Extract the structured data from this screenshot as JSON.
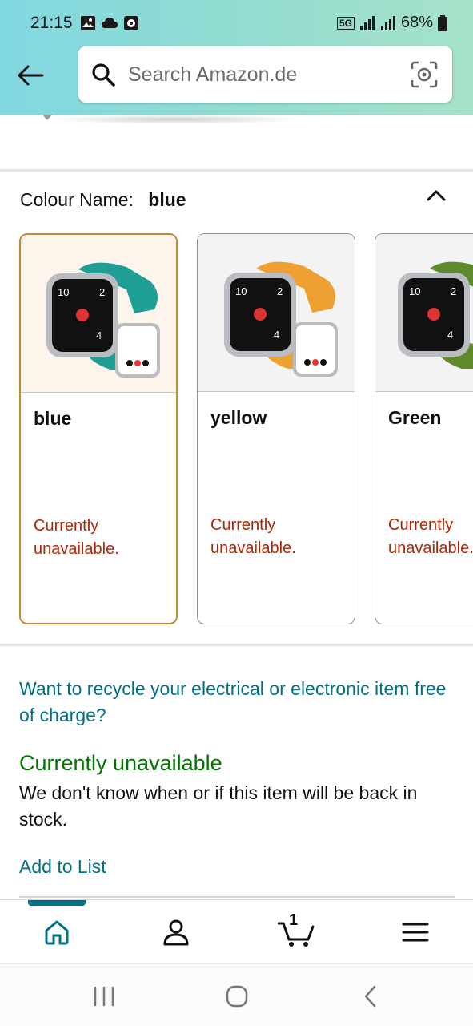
{
  "status_bar": {
    "time": "21:15",
    "network": "5G",
    "battery": "68%"
  },
  "header": {
    "search_placeholder": "Search Amazon.de"
  },
  "colour": {
    "label": "Colour Name:",
    "selected": "blue",
    "options": [
      {
        "name": "blue",
        "availability_line1": "Currently",
        "availability_line2": "unavailable.",
        "band_color": "#1f9e93"
      },
      {
        "name": "yellow",
        "availability_line1": "Currently",
        "availability_line2": "unavailable.",
        "band_color": "#eea032"
      },
      {
        "name": "Green",
        "availability_line1": "Currently",
        "availability_line2": "unavailable.",
        "band_color": "#5f8a2b"
      }
    ]
  },
  "info": {
    "recycle": "Want to recycle your electrical or electronic item free of charge?",
    "availability": "Currently unavailable",
    "stock_note": "We don't know when or if this item will be back in stock.",
    "add_to_list": "Add to List"
  },
  "bottom_nav": {
    "cart_count": "1",
    "items": [
      "home-icon",
      "account-icon",
      "cart-icon",
      "menu-icon"
    ]
  },
  "colors": {
    "link": "#007185",
    "unavailable_red": "#b12704",
    "unavailable_green": "#007600",
    "selected_border": "#c7892d"
  }
}
